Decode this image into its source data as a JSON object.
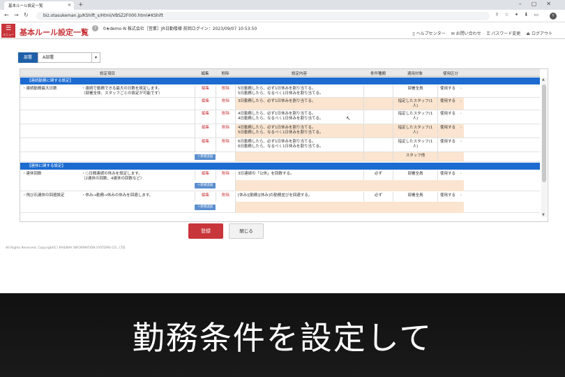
{
  "browser": {
    "tab_title": "基本ルール設定一覧",
    "url": "biz.otasukeman.jp/KShift_s/Html/VBSZ2F000.html#KShift"
  },
  "header": {
    "menu_label": "メニュー",
    "title": "基本ルール設定一覧",
    "session": "0★demo-N 株式会社［営業］JR日勤楼様 前回ログイン：2023/09/07 10:53:50",
    "links": [
      "ヘルプセンター",
      "お問い合わせ",
      "パスワード変更",
      "ログアウト"
    ]
  },
  "dept": {
    "label": "部署",
    "value": "A部署"
  },
  "table": {
    "headers": {
      "item": "設定項目",
      "edit": "編集",
      "delete": "削除",
      "content": "設定内容",
      "condition": "条件種類",
      "target": "適用対象",
      "usage": "使用区分"
    },
    "sections": {
      "s1": "【連続勤務に関する設定】",
      "s2": "【連休に関する設定】"
    },
    "rows": [
      {
        "item": "・連続勤務最大日数",
        "desc1": "・連続で勤務できる最大の日数を設定します。",
        "desc2": "（部署全体、スタッフごとの設定が可能です）",
        "edit": "編集",
        "del": "削除",
        "c1": "5日勤務したら、必ず1日休みを割り当てる。",
        "c2": "5日勤務したら、なるべく1日休みを割り当てる。",
        "cond": "",
        "target": "部署全員",
        "usage": "使用する"
      },
      {
        "edit": "編集",
        "del": "削除",
        "c1": "3日勤務したら、必ず1日休みを割り当てる。",
        "c2": "",
        "cond": "",
        "target": "指定したスタッフ(1人)",
        "usage": "使用する"
      },
      {
        "edit": "編集",
        "del": "削除",
        "c1": "4日勤務したら、必ず1日休みを割り当てる。",
        "c2": "4日勤務したら、なるべく1日休みを割り当てる。",
        "cond": "",
        "target": "指定したスタッフ(1人)",
        "usage": "使用する"
      },
      {
        "edit": "編集",
        "del": "削除",
        "c1": "4日勤務したら、必ず1日休みを割り当てる。",
        "c2": "5日勤務したら、なるべく1日休みを割り当てる。",
        "cond": "",
        "target": "指定したスタッフ(1人)",
        "usage": "使用する"
      },
      {
        "edit": "編集",
        "del": "削除",
        "c1": "6日勤務したら、必ず1日休みを割り当てる。",
        "c2": "6日勤務したら、なるべく1日休みを割り当てる。",
        "cond": "",
        "target": "指定したスタッフ(1人)",
        "usage": "使用する"
      },
      {
        "item": "・連休回数",
        "desc1": "・○日間連続の休みを設定します。",
        "desc2": "（2連休の回数、4連休の回数など）",
        "edit": "編集",
        "del": "削除",
        "c1": "3日連続の「公休」を回数する。",
        "c2": "",
        "cond": "必ず",
        "target": "部署全員",
        "usage": "使用する"
      },
      {
        "item": "・飛び石連休の回避設定",
        "desc1": "・休み→勤務→休みの休みを回避します。",
        "desc2": "",
        "edit": "編集",
        "del": "削除",
        "c1": "[休み][勤務][休み]の勤務並びを回避する。",
        "c2": "",
        "cond": "必ず",
        "target": "部署全員",
        "usage": "使用する"
      }
    ],
    "add_label": "＋新規追加",
    "staff_other": "スタッフ他"
  },
  "buttons": {
    "register": "登録",
    "close": "閉じる"
  },
  "copyright": "All Rights Reserved. Copyright(C) RAILWAY INFORMATION SYSTEMS CO., LTD.",
  "caption": "勤務条件を設定して"
}
